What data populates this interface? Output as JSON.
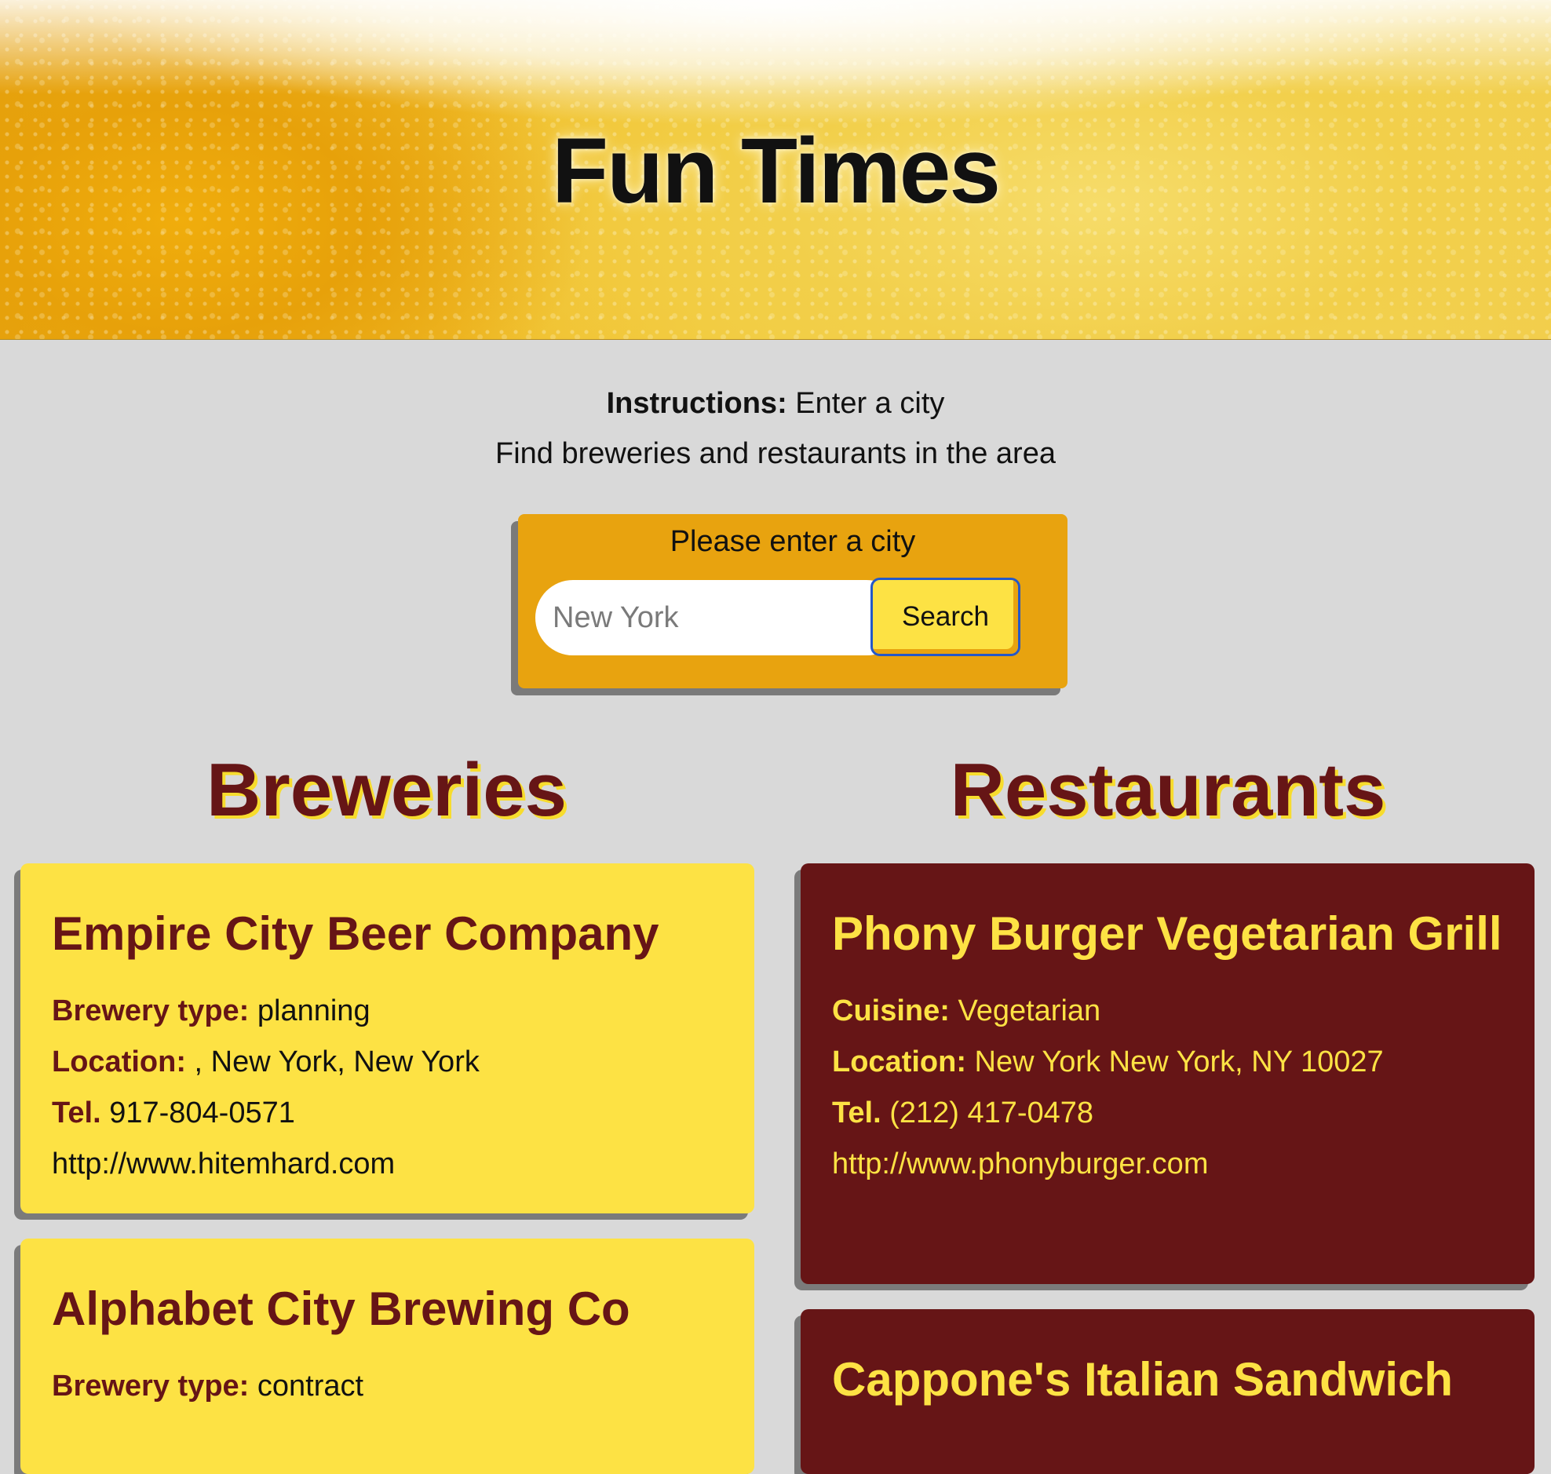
{
  "header": {
    "title": "Fun Times"
  },
  "instructions": {
    "label": "Instructions:",
    "text": "Enter a city",
    "subtext": "Find breweries and restaurants in the area"
  },
  "search": {
    "prompt": "Please enter a city",
    "placeholder": "New York",
    "button_label": "Search"
  },
  "breweries": {
    "title": "Breweries",
    "items": [
      {
        "name": "Empire City Beer Company",
        "type_label": "Brewery type:",
        "type": "planning",
        "location_label": "Location:",
        "location": ", New York, New York",
        "tel_label": "Tel.",
        "tel": "917-804-0571",
        "url": "http://www.hitemhard.com"
      },
      {
        "name": "Alphabet City Brewing Co",
        "type_label": "Brewery type:",
        "type": "contract"
      }
    ]
  },
  "restaurants": {
    "title": "Restaurants",
    "items": [
      {
        "name": "Phony Burger Vegetarian Grill",
        "cuisine_label": "Cuisine:",
        "cuisine": "Vegetarian",
        "location_label": "Location:",
        "location": "New York New York, NY 10027",
        "tel_label": "Tel.",
        "tel": "(212) 417-0478",
        "url": "http://www.phonyburger.com"
      },
      {
        "name": "Cappone's Italian Sandwich"
      }
    ]
  },
  "colors": {
    "background": "#d9d9d9",
    "accent_orange": "#e8a30f",
    "accent_yellow": "#fde244",
    "maroon": "#661516"
  }
}
